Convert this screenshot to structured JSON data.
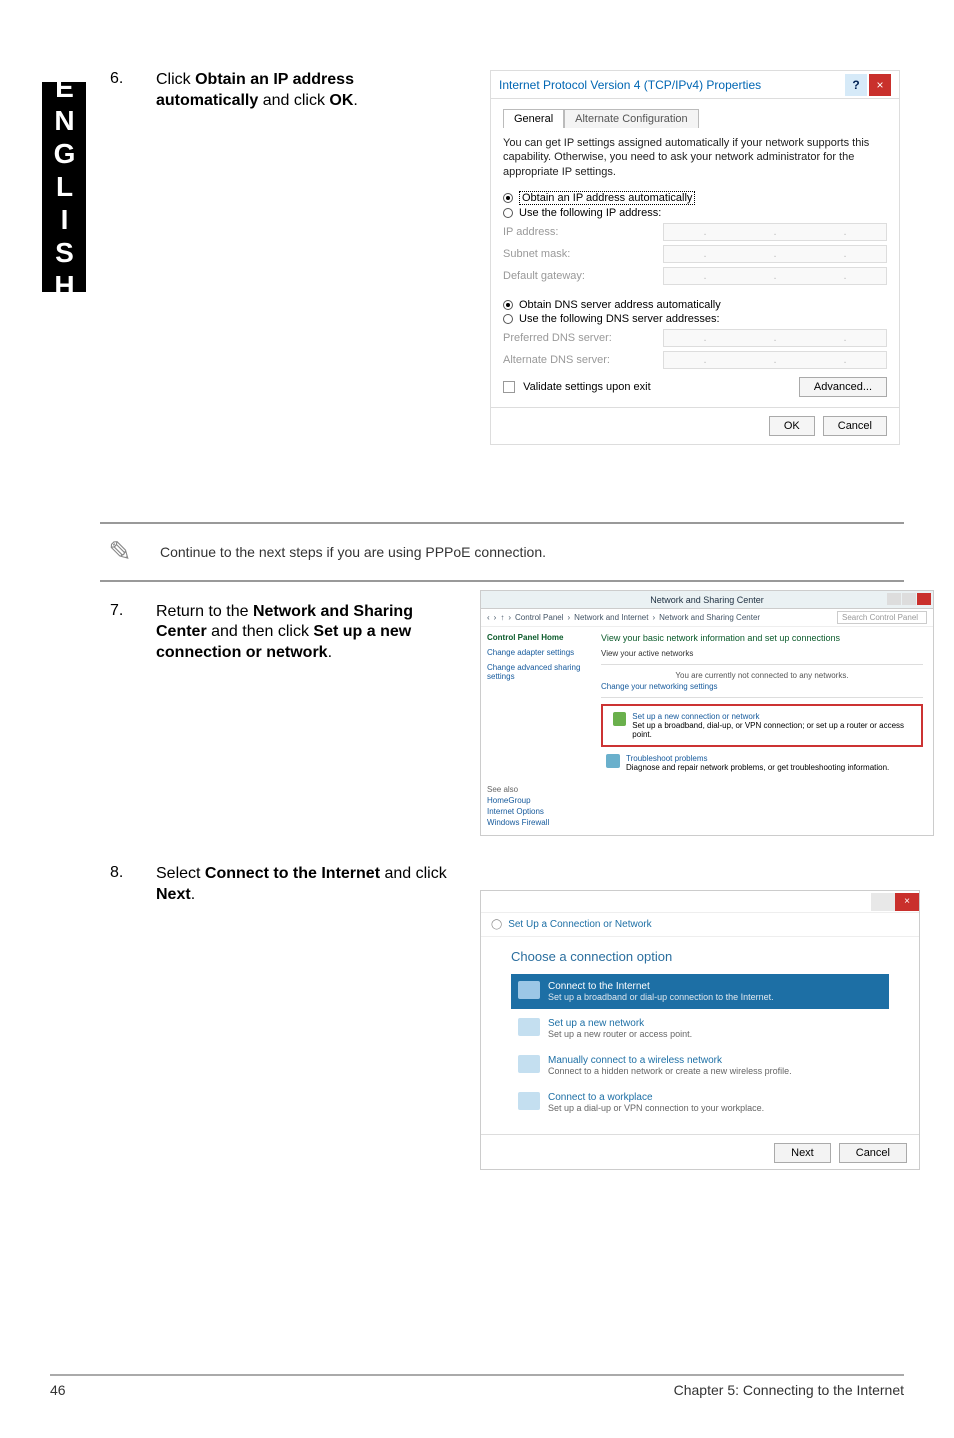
{
  "sideTab": "ENGLISH",
  "step6": {
    "num": "6.",
    "text_pre": "Click ",
    "bold1": "Obtain an IP address automatically",
    "text_mid": " and click ",
    "bold2": "OK",
    "text_post": "."
  },
  "ipv4": {
    "title": "Internet Protocol Version 4 (TCP/IPv4) Properties",
    "help": "?",
    "close": "×",
    "tab_general": "General",
    "tab_alt": "Alternate Configuration",
    "desc": "You can get IP settings assigned automatically if your network supports this capability. Otherwise, you need to ask your network administrator for the appropriate IP settings.",
    "r_auto_ip": "Obtain an IP address automatically",
    "r_manual_ip": "Use the following IP address:",
    "f_ip": "IP address:",
    "f_mask": "Subnet mask:",
    "f_gw": "Default gateway:",
    "r_auto_dns": "Obtain DNS server address automatically",
    "r_manual_dns": "Use the following DNS server addresses:",
    "f_pdns": "Preferred DNS server:",
    "f_adns": "Alternate DNS server:",
    "chk_validate": "Validate settings upon exit",
    "btn_adv": "Advanced...",
    "btn_ok": "OK",
    "btn_cancel": "Cancel",
    "dots": ". . ."
  },
  "note": "Continue to the next steps if you are using PPPoE connection.",
  "step7": {
    "num": "7.",
    "t1": "Return to the ",
    "b1": "Network and Sharing Center",
    "t2": " and then click ",
    "b2": "Set up a new connection or network",
    "t3": "."
  },
  "nsc": {
    "title": "Network and Sharing Center",
    "crumb_arrow": "›",
    "crumb1": "Control Panel",
    "crumb2": "Network and Internet",
    "crumb3": "Network and Sharing Center",
    "search_ph": "Search Control Panel",
    "side_home": "Control Panel Home",
    "side_adapter": "Change adapter settings",
    "side_sharing": "Change advanced sharing settings",
    "heading": "View your basic network information and set up connections",
    "sub1": "View your active networks",
    "sub1b": "You are currently not connected to any networks.",
    "change": "Change your networking settings",
    "opt1_t": "Set up a new connection or network",
    "opt1_d": "Set up a broadband, dial-up, or VPN connection; or set up a router or access point.",
    "opt2_t": "Troubleshoot problems",
    "opt2_d": "Diagnose and repair network problems, or get troubleshooting information.",
    "see_also": "See also",
    "sa1": "HomeGroup",
    "sa2": "Internet Options",
    "sa3": "Windows Firewall"
  },
  "step8": {
    "num": "8.",
    "t1": "Select ",
    "b1": "Connect to the Internet",
    "t2": " and click ",
    "b2": "Next",
    "t3": "."
  },
  "wiz": {
    "title": "Set Up a Connection or Network",
    "heading": "Choose a connection option",
    "o1_t": "Connect to the Internet",
    "o1_d": "Set up a broadband or dial-up connection to the Internet.",
    "o2_t": "Set up a new network",
    "o2_d": "Set up a new router or access point.",
    "o3_t": "Manually connect to a wireless network",
    "o3_d": "Connect to a hidden network or create a new wireless profile.",
    "o4_t": "Connect to a workplace",
    "o4_d": "Set up a dial-up or VPN connection to your workplace.",
    "btn_next": "Next",
    "btn_cancel": "Cancel",
    "close": "×"
  },
  "footer": {
    "page": "46",
    "chapter": "Chapter 5: Connecting to the Internet"
  }
}
